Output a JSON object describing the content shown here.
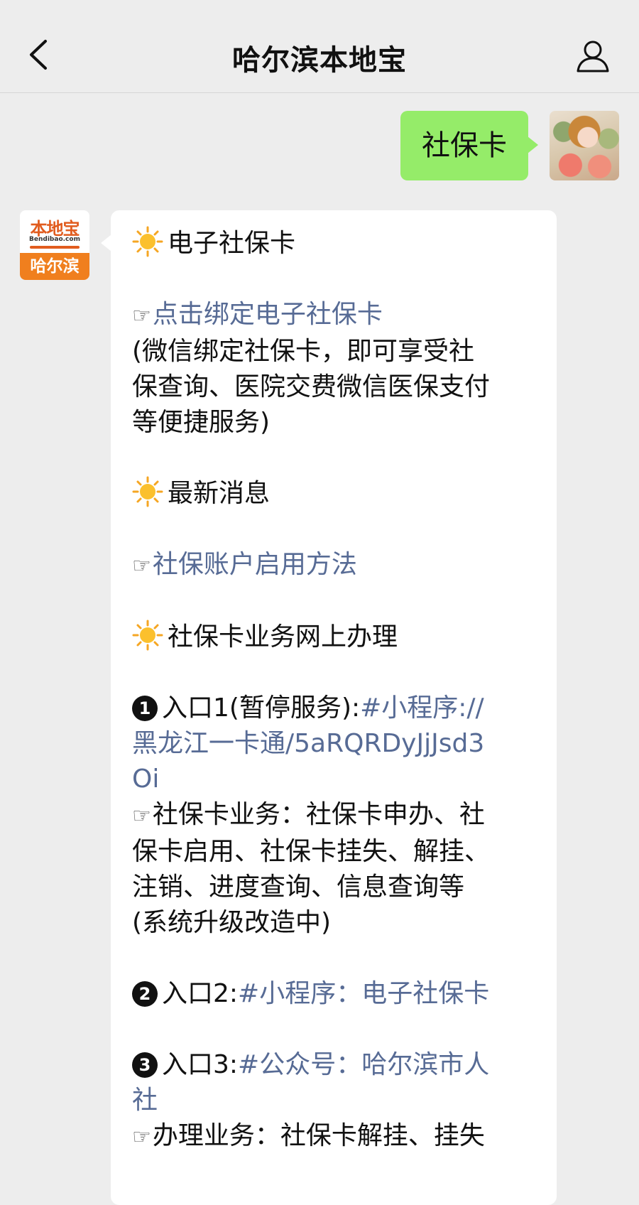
{
  "nav": {
    "back_icon": "chevron-left-icon",
    "title": "哈尔滨本地宝",
    "profile_icon": "user-icon"
  },
  "outgoing": {
    "text": "社保卡",
    "bubble_color": "#95ec69"
  },
  "bot": {
    "logo_top": "本地宝",
    "logo_site": "Bendibao.com",
    "logo_city": "哈尔滨"
  },
  "message": {
    "s1_title": "电子社保卡",
    "s1_link": "点击绑定电子社保卡",
    "s1_desc": [
      "(微信绑定社保卡，即可享受社",
      "保查询、医院交费微信医保支付",
      "等便捷服务)"
    ],
    "s2_title": "最新消息",
    "s2_link": "社保账户启用方法",
    "s3_title": "社保卡业务网上办理",
    "e1_num": "1",
    "e1_label": "入口1(暂停服务):",
    "e1_link": [
      "#小程序://",
      "黑龙江一卡通/5aRQRDyJjJsd3",
      "Oi"
    ],
    "e1_desc": [
      "社保卡业务：社保卡申办、社",
      "保卡启用、社保卡挂失、解挂、",
      "注销、进度查询、信息查询等",
      "(系统升级改造中)"
    ],
    "e2_num": "2",
    "e2_label": "入口2:",
    "e2_link": "#小程序：电子社保卡",
    "e3_num": "3",
    "e3_label": "入口3:",
    "e3_link": [
      "#公众号：哈尔滨市人",
      "社"
    ],
    "e3_desc": "办理业务：社保卡解挂、挂失",
    "link_color": "#576b95"
  }
}
